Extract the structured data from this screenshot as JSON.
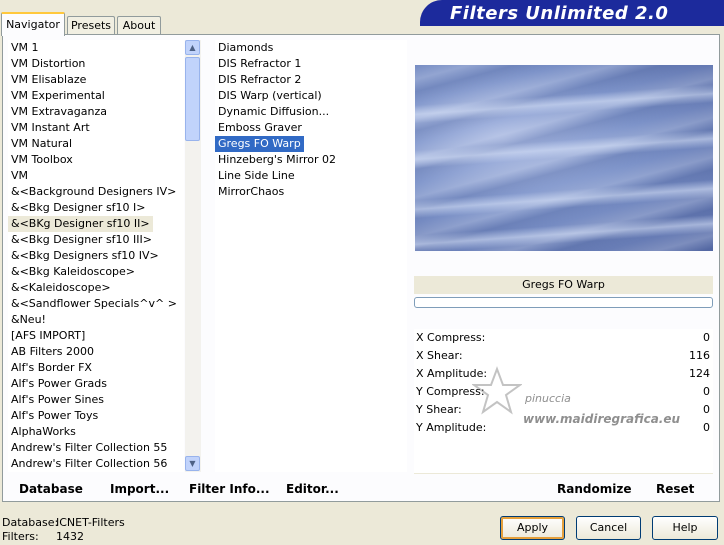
{
  "tabs": [
    "Navigator",
    "Presets",
    "About"
  ],
  "banner_title": "Filters Unlimited 2.0",
  "category_list": [
    "VM 1",
    "VM Distortion",
    "VM Elisablaze",
    "VM Experimental",
    "VM Extravaganza",
    "VM Instant Art",
    "VM Natural",
    "VM Toolbox",
    "VM",
    "&<Background Designers IV>",
    "&<Bkg Designer sf10 I>",
    "&<BKg Designer sf10 II>",
    "&<Bkg Designer sf10 III>",
    "&<Bkg Designers sf10 IV>",
    "&<Bkg Kaleidoscope>",
    "&<Kaleidoscope>",
    "&<Sandflower Specials^v^ >",
    "&Neu!",
    "[AFS IMPORT]",
    "AB Filters 2000",
    "Alf's Border FX",
    "Alf's Power Grads",
    "Alf's Power Sines",
    "Alf's Power Toys",
    "AlphaWorks",
    "Andrew's Filter Collection 55",
    "Andrew's Filter Collection 56"
  ],
  "category_selected": "&<BKg Designer sf10 II>",
  "filter_list": [
    "Diamonds",
    "DIS Refractor 1",
    "DIS Refractor 2",
    "DIS Warp (vertical)",
    "Dynamic Diffusion...",
    "Emboss Graver",
    "Gregs FO Warp",
    "Hinzeberg's Mirror 02",
    "Line Side Line",
    "MirrorChaos"
  ],
  "filter_selected": "Gregs FO Warp",
  "selected_filter_name": "Gregs FO Warp",
  "parameters": [
    {
      "label": "X Compress:",
      "value": "0"
    },
    {
      "label": "X Shear:",
      "value": "116"
    },
    {
      "label": "X Amplitude:",
      "value": "124"
    },
    {
      "label": "Y Compress:",
      "value": "0"
    },
    {
      "label": "Y Shear:",
      "value": "0"
    },
    {
      "label": "Y Amplitude:",
      "value": "0"
    }
  ],
  "watermark": {
    "line1": "pinuccia",
    "line2": "www.maidiregrafica.eu"
  },
  "bottom_toolbar": {
    "database": "Database",
    "import": "Import...",
    "filter_info": "Filter Info...",
    "editor": "Editor...",
    "randomize": "Randomize",
    "reset": "Reset"
  },
  "status": {
    "database_label": "Database:",
    "database_value": "ICNET-Filters",
    "filters_label": "Filters:",
    "filters_value": "1432"
  },
  "buttons": {
    "apply": "Apply",
    "cancel": "Cancel",
    "help": "Help"
  },
  "colors": {
    "banner": "#1c2a9c",
    "selection": "#316ac5",
    "window": "#ece9d8"
  }
}
